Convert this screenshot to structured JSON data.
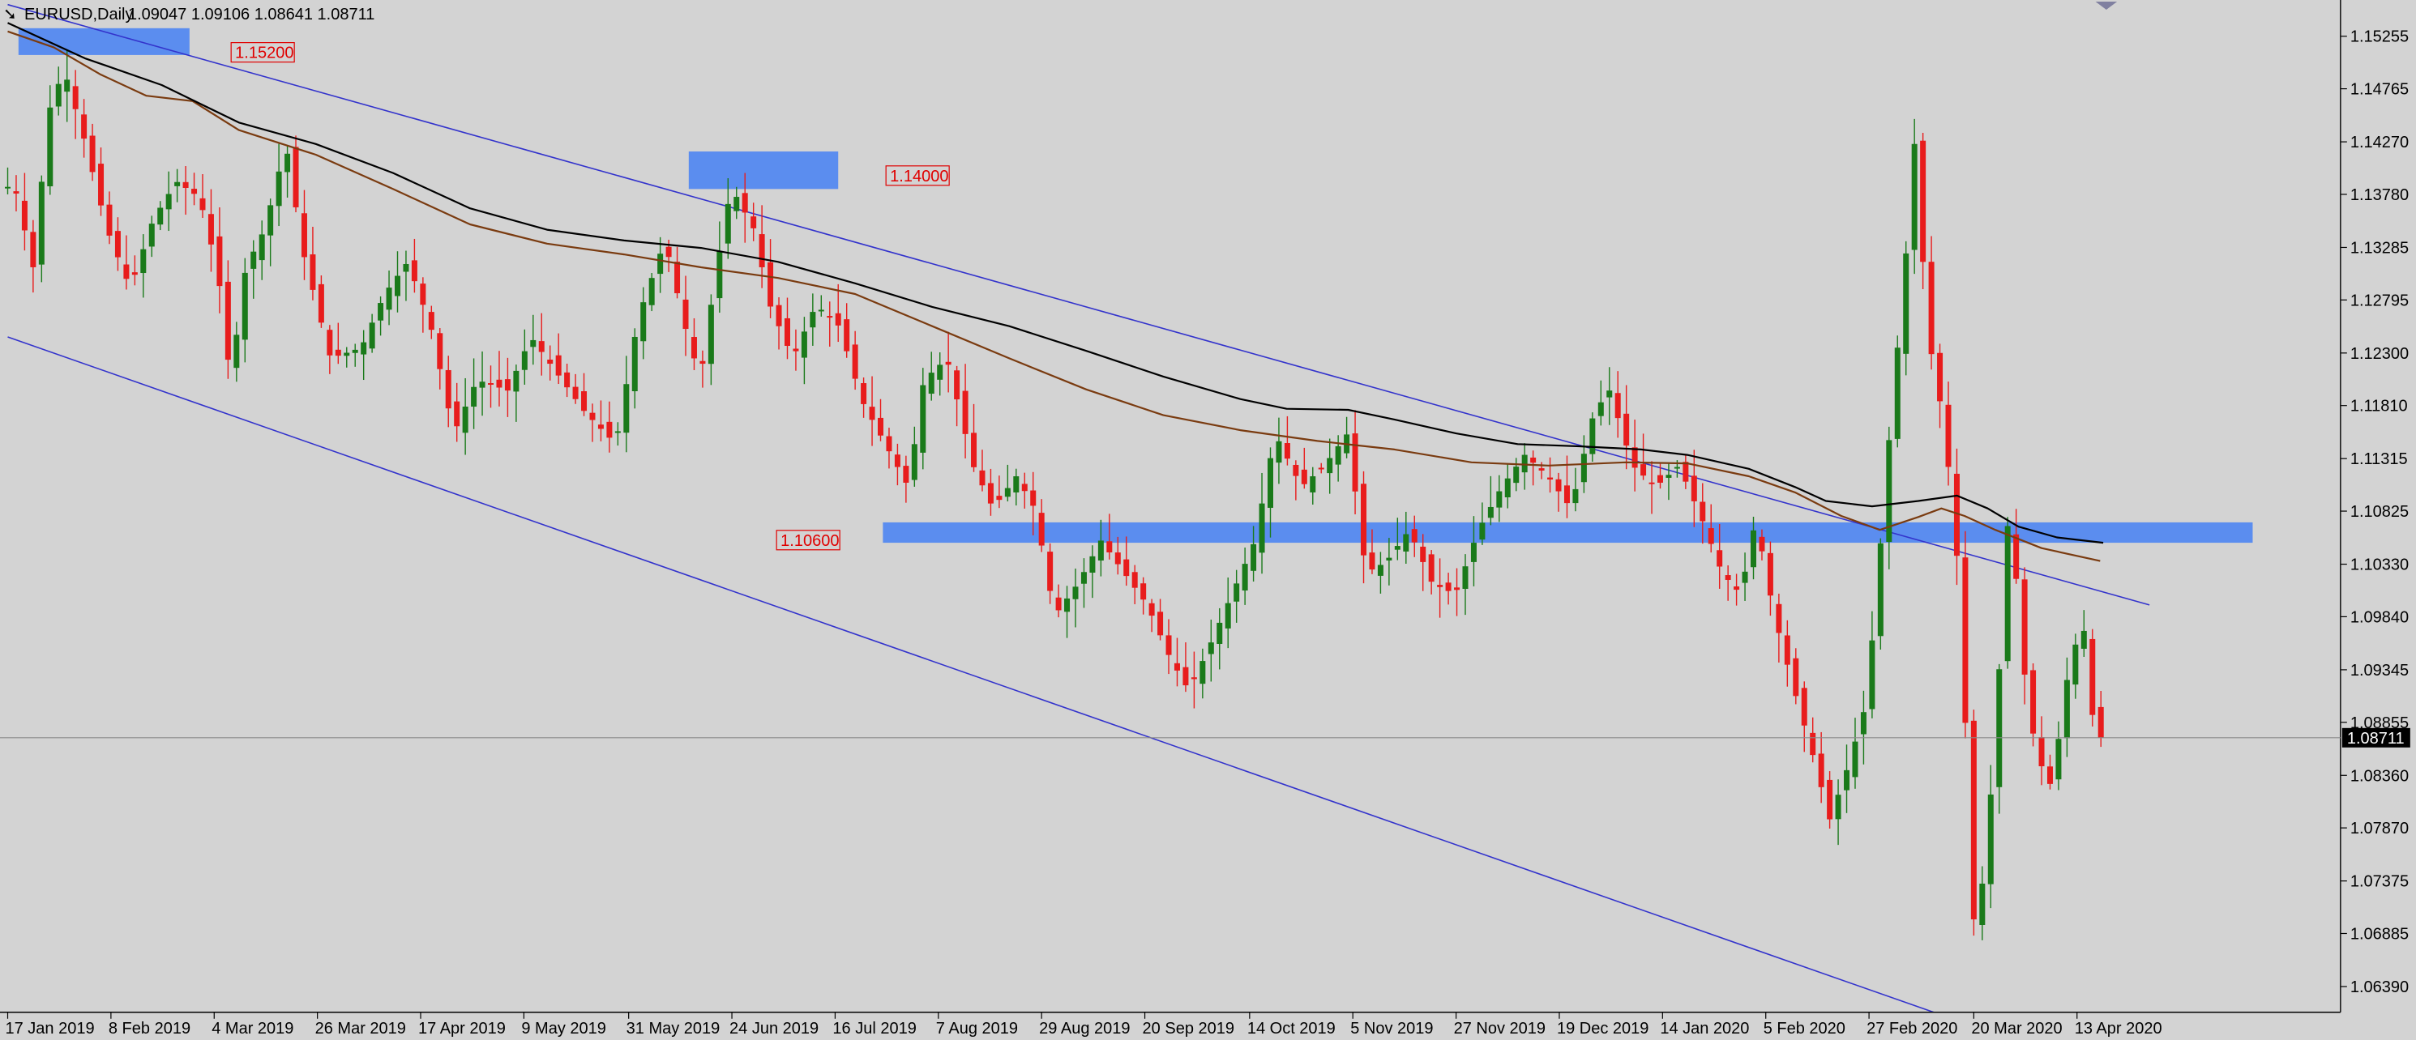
{
  "header": {
    "symbol": "EURUSD,Daily",
    "ohlc": "1.09047 1.09106 1.08641 1.08711"
  },
  "colors": {
    "background": "#d3d3d3",
    "bull": "#1a7a1a",
    "bear": "#e81c1c",
    "channel": "#3333cc",
    "zone": "#5b8def",
    "ma_fast": "#7a3b10",
    "ma_slow": "#000000",
    "level_label": "#e00000"
  },
  "chart_data": {
    "type": "candlestick",
    "ylim": [
      1.0615,
      1.1555
    ],
    "y_ticks": [
      "1.15255",
      "1.14765",
      "1.14270",
      "1.13780",
      "1.13285",
      "1.12795",
      "1.12300",
      "1.11810",
      "1.11315",
      "1.10825",
      "1.10330",
      "1.09840",
      "1.09345",
      "1.08855",
      "1.08360",
      "1.07870",
      "1.07375",
      "1.06885",
      "1.06390"
    ],
    "x_labels": [
      "17 Jan 2019",
      "8 Feb 2019",
      "4 Mar 2019",
      "26 Mar 2019",
      "17 Apr 2019",
      "9 May 2019",
      "31 May 2019",
      "24 Jun 2019",
      "16 Jul 2019",
      "7 Aug 2019",
      "29 Aug 2019",
      "20 Sep 2019",
      "14 Oct 2019",
      "5 Nov 2019",
      "27 Nov 2019",
      "19 Dec 2019",
      "14 Jan 2020",
      "5 Feb 2020",
      "27 Feb 2020",
      "20 Mar 2020",
      "13 Apr 2020"
    ],
    "current_price": "1.08711",
    "levels": [
      {
        "label": "1.15200",
        "value": 1.152,
        "zone": [
          1.1508,
          1.1533
        ]
      },
      {
        "label": "1.14000",
        "value": 1.14,
        "zone": [
          1.1383,
          1.1418
        ]
      },
      {
        "label": "1.10600",
        "value": 1.106,
        "zone": [
          1.1053,
          1.1072
        ]
      }
    ],
    "channel_upper": [
      [
        0,
        1.1555
      ],
      [
        1390,
        1.0995
      ]
    ],
    "channel_lower": [
      [
        0,
        1.1245
      ],
      [
        1250,
        1.0615
      ]
    ],
    "ma_slow_points": [
      [
        0,
        1.1538
      ],
      [
        50,
        1.1505
      ],
      [
        100,
        1.148
      ],
      [
        150,
        1.1445
      ],
      [
        200,
        1.1425
      ],
      [
        250,
        1.1398
      ],
      [
        300,
        1.1365
      ],
      [
        350,
        1.1345
      ],
      [
        400,
        1.1335
      ],
      [
        450,
        1.1328
      ],
      [
        500,
        1.1315
      ],
      [
        550,
        1.1295
      ],
      [
        600,
        1.1273
      ],
      [
        650,
        1.1255
      ],
      [
        700,
        1.1232
      ],
      [
        750,
        1.1208
      ],
      [
        800,
        1.1187
      ],
      [
        830,
        1.1178
      ],
      [
        870,
        1.1177
      ],
      [
        900,
        1.1168
      ],
      [
        940,
        1.1155
      ],
      [
        980,
        1.1145
      ],
      [
        1020,
        1.1143
      ],
      [
        1060,
        1.114
      ],
      [
        1090,
        1.1135
      ],
      [
        1130,
        1.1122
      ],
      [
        1160,
        1.1105
      ],
      [
        1180,
        1.1092
      ],
      [
        1210,
        1.1087
      ],
      [
        1240,
        1.1092
      ],
      [
        1265,
        1.1097
      ],
      [
        1285,
        1.1085
      ],
      [
        1305,
        1.1068
      ],
      [
        1330,
        1.1058
      ],
      [
        1360,
        1.1053
      ]
    ],
    "ma_fast_points": [
      [
        0,
        1.153
      ],
      [
        30,
        1.1515
      ],
      [
        60,
        1.149
      ],
      [
        90,
        1.147
      ],
      [
        120,
        1.1465
      ],
      [
        150,
        1.1438
      ],
      [
        200,
        1.1415
      ],
      [
        250,
        1.1383
      ],
      [
        300,
        1.135
      ],
      [
        350,
        1.1332
      ],
      [
        400,
        1.1322
      ],
      [
        450,
        1.131
      ],
      [
        500,
        1.13
      ],
      [
        550,
        1.1285
      ],
      [
        600,
        1.1255
      ],
      [
        650,
        1.1225
      ],
      [
        700,
        1.1196
      ],
      [
        750,
        1.1172
      ],
      [
        800,
        1.1158
      ],
      [
        850,
        1.1148
      ],
      [
        900,
        1.114
      ],
      [
        950,
        1.1128
      ],
      [
        1000,
        1.1125
      ],
      [
        1050,
        1.1128
      ],
      [
        1090,
        1.1127
      ],
      [
        1130,
        1.1115
      ],
      [
        1160,
        1.11
      ],
      [
        1190,
        1.1078
      ],
      [
        1215,
        1.1065
      ],
      [
        1240,
        1.1077
      ],
      [
        1255,
        1.1085
      ],
      [
        1270,
        1.1078
      ],
      [
        1290,
        1.1065
      ],
      [
        1320,
        1.1048
      ],
      [
        1358,
        1.1036
      ]
    ],
    "key_points": [
      [
        0,
        1.1385
      ],
      [
        10,
        1.1385
      ],
      [
        22,
        1.131
      ],
      [
        32,
        1.1455
      ],
      [
        42,
        1.1495
      ],
      [
        55,
        1.143
      ],
      [
        70,
        1.1345
      ],
      [
        85,
        1.129
      ],
      [
        100,
        1.1355
      ],
      [
        115,
        1.139
      ],
      [
        130,
        1.1375
      ],
      [
        142,
        1.1305
      ],
      [
        150,
        1.1205
      ],
      [
        160,
        1.131
      ],
      [
        172,
        1.1345
      ],
      [
        186,
        1.1425
      ],
      [
        197,
        1.1325
      ],
      [
        215,
        1.1225
      ],
      [
        235,
        1.1235
      ],
      [
        250,
        1.1285
      ],
      [
        265,
        1.1315
      ],
      [
        280,
        1.1255
      ],
      [
        295,
        1.1155
      ],
      [
        310,
        1.1205
      ],
      [
        330,
        1.1195
      ],
      [
        345,
        1.1245
      ],
      [
        360,
        1.1215
      ],
      [
        380,
        1.1175
      ],
      [
        400,
        1.1145
      ],
      [
        415,
        1.1265
      ],
      [
        432,
        1.1335
      ],
      [
        445,
        1.1255
      ],
      [
        455,
        1.1205
      ],
      [
        465,
        1.1305
      ],
      [
        475,
        1.1385
      ],
      [
        490,
        1.1345
      ],
      [
        500,
        1.1275
      ],
      [
        515,
        1.1225
      ],
      [
        530,
        1.1275
      ],
      [
        545,
        1.1255
      ],
      [
        560,
        1.1185
      ],
      [
        575,
        1.1145
      ],
      [
        590,
        1.1105
      ],
      [
        600,
        1.1205
      ],
      [
        615,
        1.1225
      ],
      [
        632,
        1.1125
      ],
      [
        645,
        1.1085
      ],
      [
        660,
        1.1115
      ],
      [
        672,
        1.1085
      ],
      [
        685,
        1.0985
      ],
      [
        700,
        1.1015
      ],
      [
        715,
        1.1055
      ],
      [
        730,
        1.1025
      ],
      [
        745,
        1.0995
      ],
      [
        760,
        1.0945
      ],
      [
        772,
        1.0915
      ],
      [
        785,
        1.0955
      ],
      [
        800,
        1.1005
      ],
      [
        815,
        1.1055
      ],
      [
        828,
        1.1155
      ],
      [
        845,
        1.1105
      ],
      [
        860,
        1.1125
      ],
      [
        875,
        1.1155
      ],
      [
        887,
        1.1025
      ],
      [
        900,
        1.1035
      ],
      [
        915,
        1.1065
      ],
      [
        930,
        1.1015
      ],
      [
        945,
        1.1005
      ],
      [
        960,
        1.1065
      ],
      [
        975,
        1.1105
      ],
      [
        990,
        1.1135
      ],
      [
        1005,
        1.1115
      ],
      [
        1020,
        1.1085
      ],
      [
        1035,
        1.1175
      ],
      [
        1045,
        1.1195
      ],
      [
        1060,
        1.1125
      ],
      [
        1075,
        1.1105
      ],
      [
        1090,
        1.1125
      ],
      [
        1105,
        1.1075
      ],
      [
        1118,
        1.1025
      ],
      [
        1130,
        1.1005
      ],
      [
        1140,
        1.1075
      ],
      [
        1152,
        1.0985
      ],
      [
        1165,
        1.0915
      ],
      [
        1177,
        1.0855
      ],
      [
        1188,
        1.0795
      ],
      [
        1200,
        1.0845
      ],
      [
        1212,
        1.0905
      ],
      [
        1220,
        1.1035
      ],
      [
        1228,
        1.1175
      ],
      [
        1236,
        1.1295
      ],
      [
        1243,
        1.1425
      ],
      [
        1252,
        1.1245
      ],
      [
        1262,
        1.1165
      ],
      [
        1270,
        1.1055
      ],
      [
        1276,
        1.0885
      ],
      [
        1282,
        1.0685
      ],
      [
        1290,
        1.0765
      ],
      [
        1298,
        1.0935
      ],
      [
        1305,
        1.1105
      ],
      [
        1312,
        1.0955
      ],
      [
        1322,
        1.0855
      ],
      [
        1332,
        1.0825
      ],
      [
        1342,
        1.0925
      ],
      [
        1352,
        1.0985
      ],
      [
        1360,
        1.0871
      ]
    ]
  }
}
